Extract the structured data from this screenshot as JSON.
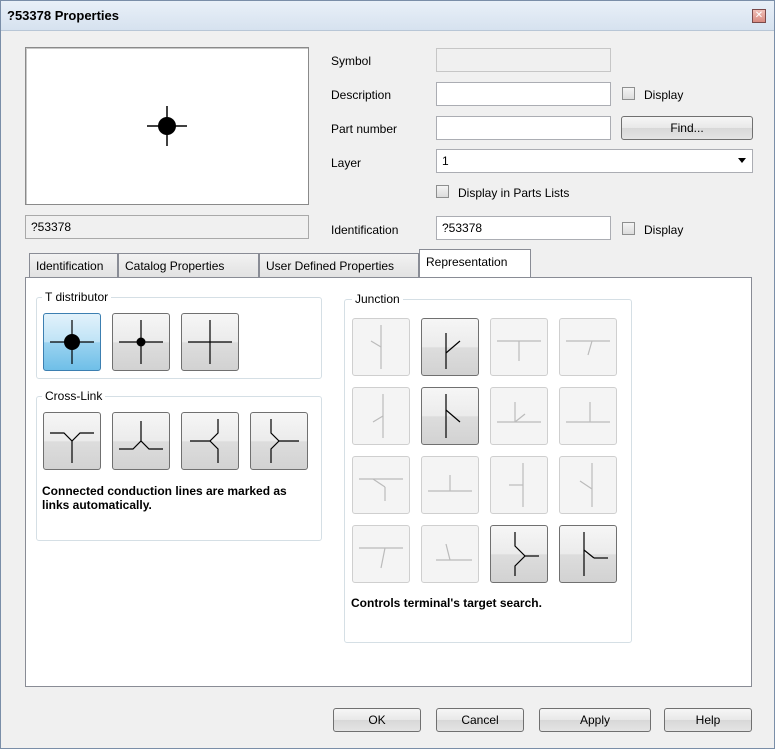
{
  "window": {
    "title": "?53378 Properties"
  },
  "preview": {
    "name": "?53378"
  },
  "form": {
    "symbol_label": "Symbol",
    "symbol_value": "",
    "description_label": "Description",
    "description_value": "",
    "description_display_label": "Display",
    "part_number_label": "Part number",
    "part_number_value": "",
    "find_button": "Find...",
    "layer_label": "Layer",
    "layer_value": "1",
    "parts_list_label": "Display in Parts Lists",
    "identification_label": "Identification",
    "identification_value": "?53378",
    "identification_display_label": "Display"
  },
  "tabs": [
    {
      "label": "Identification"
    },
    {
      "label": "Catalog Properties"
    },
    {
      "label": "User Defined Properties"
    },
    {
      "label": "Representation"
    }
  ],
  "representation": {
    "t_distributor_title": "T distributor",
    "cross_link_title": "Cross-Link",
    "cross_link_note": "Connected conduction lines are marked as links automatically.",
    "junction_title": "Junction",
    "junction_note": "Controls terminal's target search."
  },
  "buttons": {
    "ok": "OK",
    "cancel": "Cancel",
    "apply": "Apply",
    "help": "Help"
  }
}
